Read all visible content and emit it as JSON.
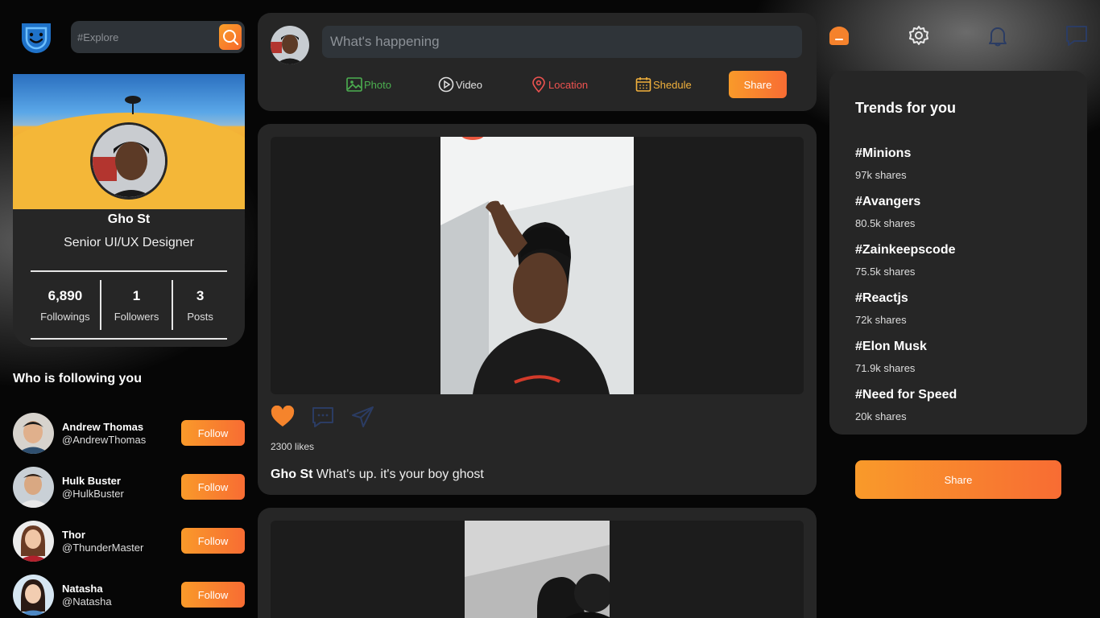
{
  "search": {
    "placeholder": "#Explore"
  },
  "profile": {
    "name": "Gho St",
    "role": "Senior UI/UX Designer",
    "stats": [
      {
        "value": "6,890",
        "label": "Followings"
      },
      {
        "value": "1",
        "label": "Followers"
      },
      {
        "value": "3",
        "label": "Posts"
      }
    ]
  },
  "followers": {
    "title": "Who is following you",
    "items": [
      {
        "name": "Andrew Thomas",
        "handle": "@AndrewThomas",
        "button": "Follow"
      },
      {
        "name": "Hulk Buster",
        "handle": "@HulkBuster",
        "button": "Follow"
      },
      {
        "name": "Thor",
        "handle": "@ThunderMaster",
        "button": "Follow"
      },
      {
        "name": "Natasha",
        "handle": "@Natasha",
        "button": "Follow"
      }
    ]
  },
  "composer": {
    "placeholder": "What's happening",
    "options": [
      {
        "label": "Photo",
        "color": "#4caf50"
      },
      {
        "label": "Video",
        "color": "#e0e0e0"
      },
      {
        "label": "Location",
        "color": "#ef5350"
      },
      {
        "label": "Shedule",
        "color": "#f2b13c"
      }
    ],
    "share_label": "Share"
  },
  "post": {
    "likes": "2300 likes",
    "author": "Gho St",
    "text": "What's up. it's your boy ghost"
  },
  "nav": {
    "icons": [
      "home-icon",
      "gear-icon",
      "bell-icon",
      "comment-icon"
    ]
  },
  "trends": {
    "title": "Trends for you",
    "items": [
      {
        "tag": "#Minions",
        "count": "97k shares"
      },
      {
        "tag": "#Avangers",
        "count": "80.5k shares"
      },
      {
        "tag": "#Zainkeepscode",
        "count": "75.5k shares"
      },
      {
        "tag": "#Reactjs",
        "count": "72k shares"
      },
      {
        "tag": "#Elon Musk",
        "count": "71.9k shares"
      },
      {
        "tag": "#Need for Speed",
        "count": "20k shares"
      }
    ]
  },
  "share_button": "Share",
  "colors": {
    "accent_start": "#f99a2a",
    "accent_end": "#f86c33",
    "card": "#262626"
  }
}
